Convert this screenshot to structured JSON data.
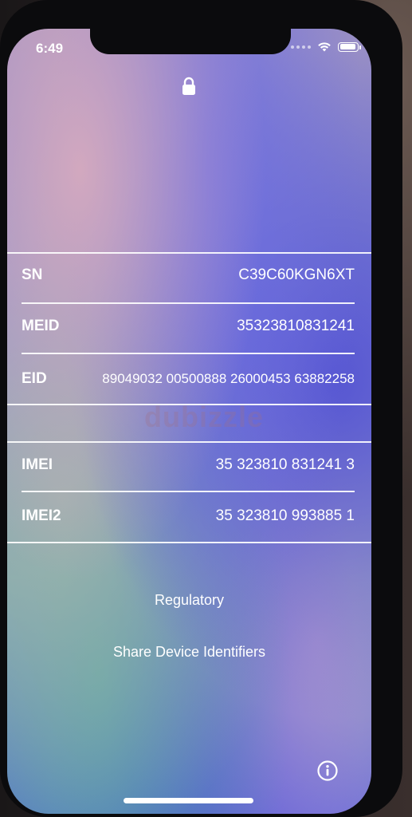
{
  "status_bar": {
    "time": "6:49",
    "battery_level": 0.95,
    "icons": [
      "cellular-dots-icon",
      "wifi-icon",
      "battery-icon"
    ]
  },
  "header": {
    "icon": "lock-icon"
  },
  "identifiers": {
    "sn": {
      "label": "SN",
      "value": "C39C60KGN6XT"
    },
    "meid": {
      "label": "MEID",
      "value": "35323810831241"
    },
    "eid": {
      "label": "EID",
      "value": "89049032 00500888 26000453 63882258"
    },
    "imei": {
      "label": "IMEI",
      "value": "35 323810 831241 3"
    },
    "imei2": {
      "label": "IMEI2",
      "value": "35 323810 993885 1"
    }
  },
  "watermark": "dubizzle",
  "links": {
    "regulatory": "Regulatory",
    "share": "Share Device Identifiers"
  },
  "footer": {
    "icon": "info-icon"
  },
  "colors": {
    "text": "#ffffff",
    "separator": "#ffffff"
  }
}
